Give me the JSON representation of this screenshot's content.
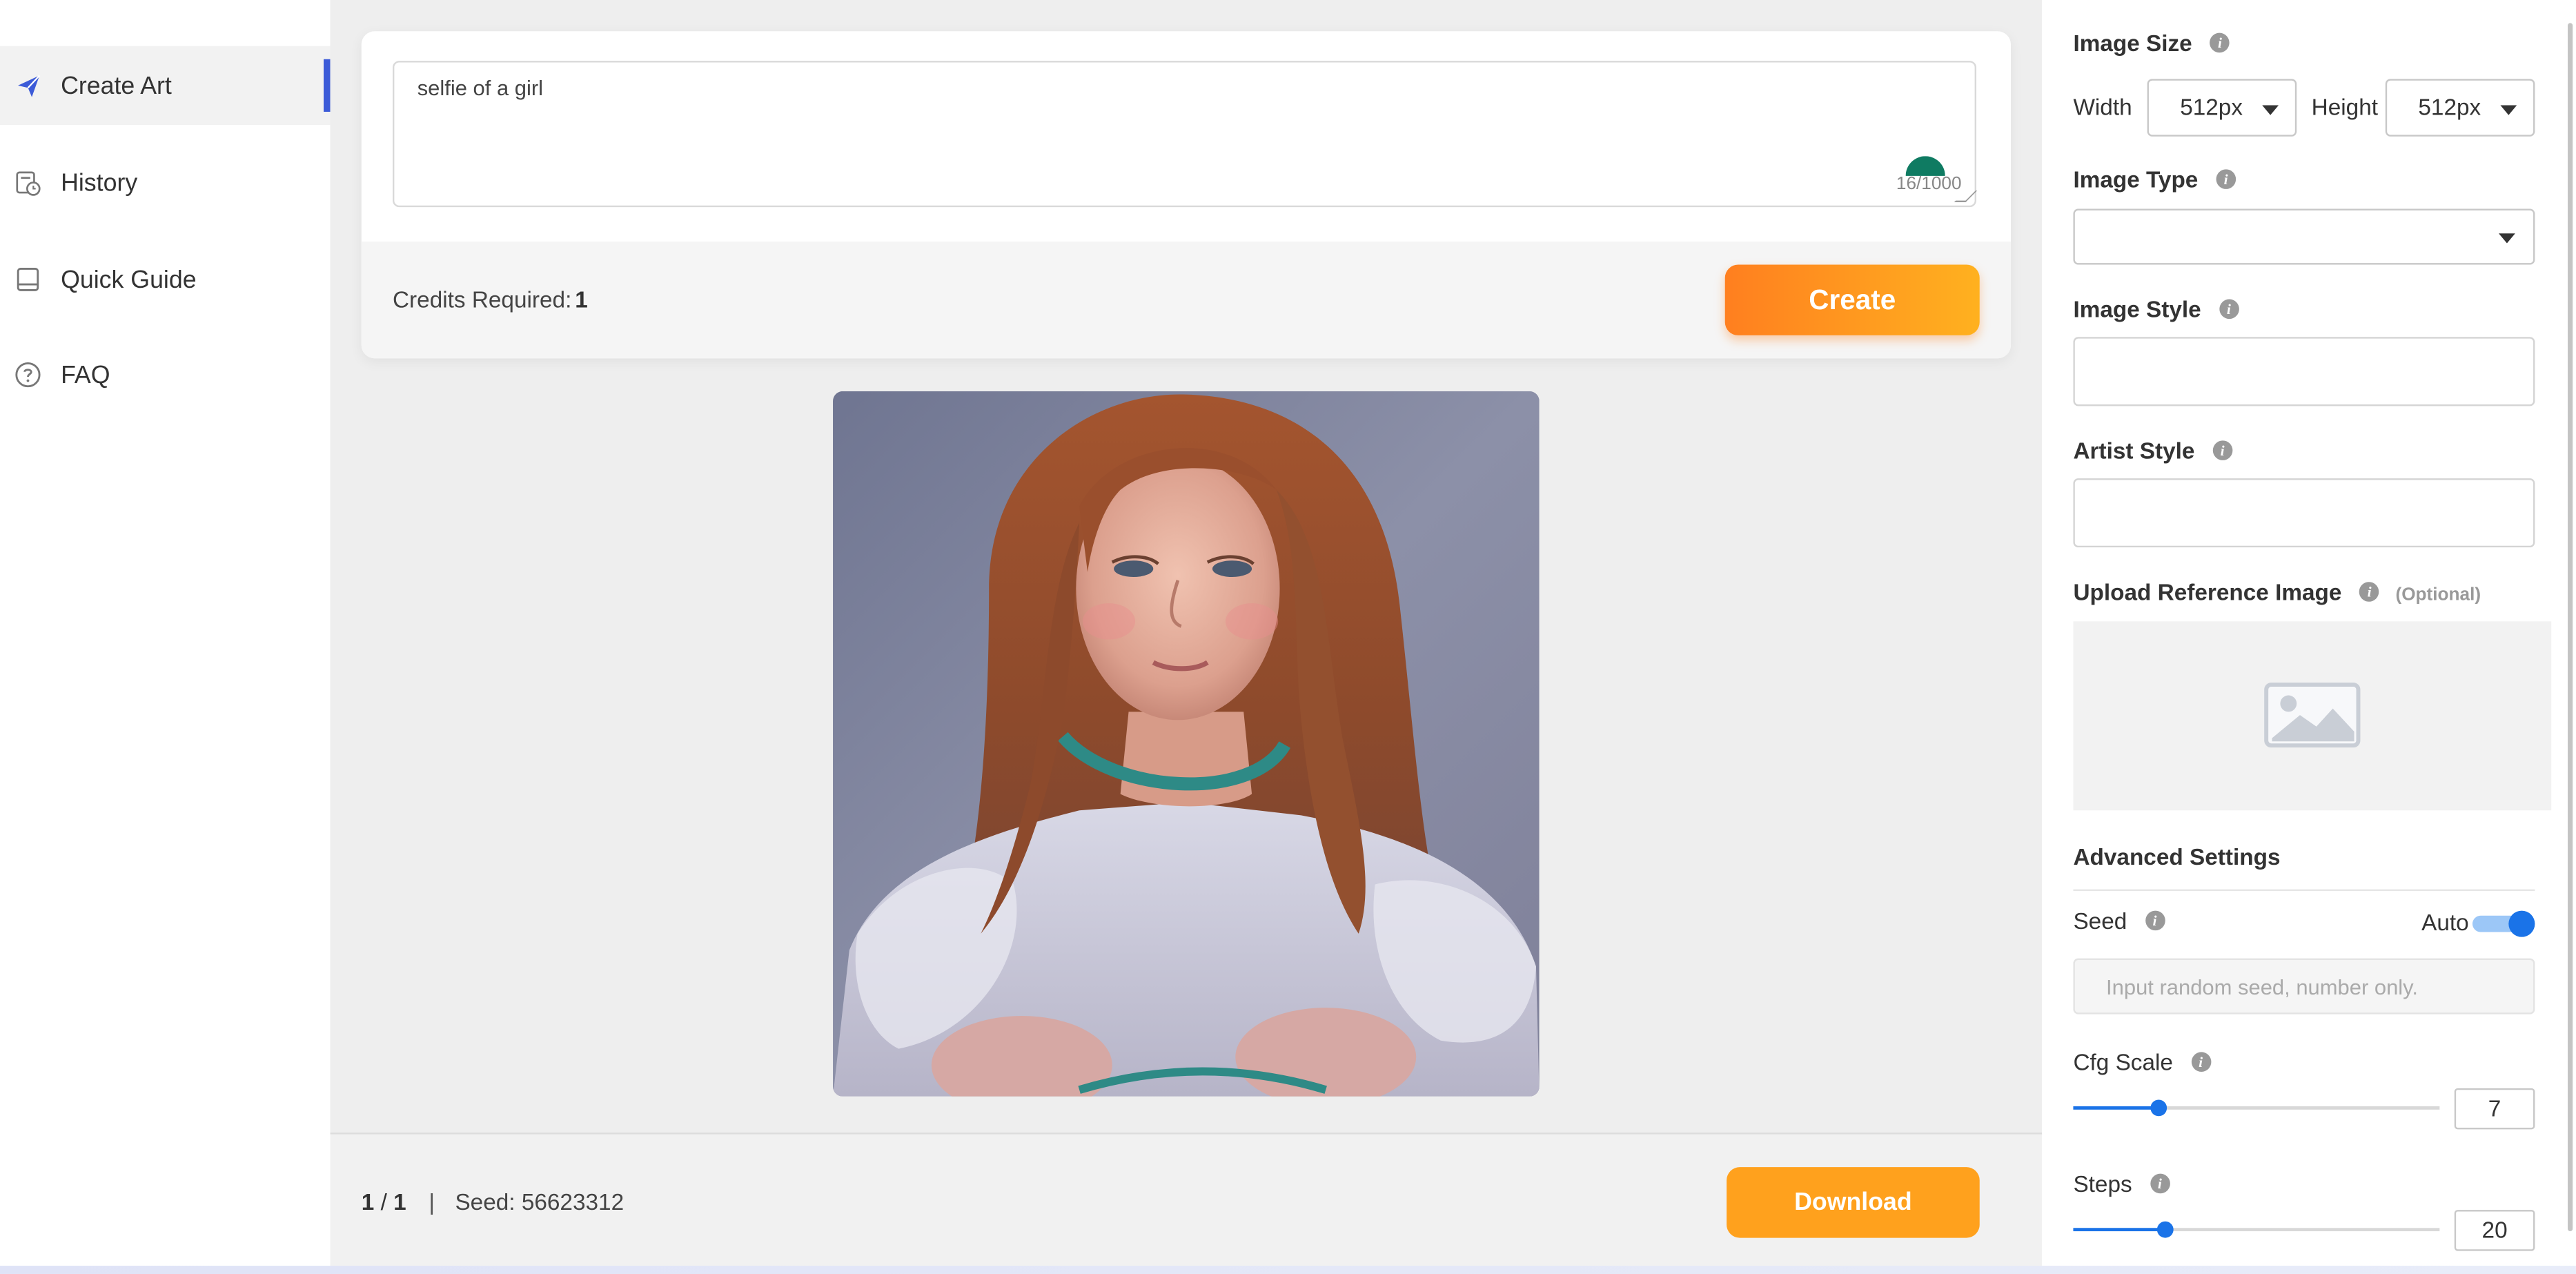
{
  "sidebar": {
    "items": [
      {
        "label": "Create Art",
        "icon": "paper-plane-icon",
        "active": true
      },
      {
        "label": "History",
        "icon": "history-doc-icon"
      },
      {
        "label": "Quick Guide",
        "icon": "book-icon"
      },
      {
        "label": "FAQ",
        "icon": "question-circle-icon"
      }
    ]
  },
  "prompt": {
    "value": "selfie of a girl",
    "char_count": "16/1000"
  },
  "credits": {
    "label": "Credits Required:",
    "value": "1"
  },
  "create_label": "Create",
  "result": {
    "page_current": "1",
    "page_sep": "/",
    "page_total": "1",
    "divider": "|",
    "seed_text": "Seed: 56623312",
    "download_label": "Download"
  },
  "settings": {
    "image_size": {
      "title": "Image Size",
      "width_label": "Width",
      "width_value": "512px",
      "height_label": "Height",
      "height_value": "512px"
    },
    "image_type": {
      "title": "Image Type",
      "value": ""
    },
    "image_style": {
      "title": "Image Style",
      "value": ""
    },
    "artist_style": {
      "title": "Artist Style",
      "value": ""
    },
    "upload": {
      "title": "Upload Reference Image",
      "optional": "(Optional)"
    },
    "advanced": {
      "title": "Advanced Settings",
      "seed_label": "Seed",
      "auto_label": "Auto",
      "auto_enabled": true,
      "seed_placeholder": "Input random seed, number only.",
      "cfg_label": "Cfg Scale",
      "cfg_value": "7",
      "cfg_fraction": 0.235,
      "steps_label": "Steps",
      "steps_value": "20",
      "steps_fraction": 0.25
    }
  },
  "colors": {
    "accent": "#1a73e8",
    "create_gradient_start": "#ff7f1f",
    "create_gradient_end": "#ffb11f",
    "download": "#ffa11d",
    "active_indicator": "#3c5bd8"
  }
}
